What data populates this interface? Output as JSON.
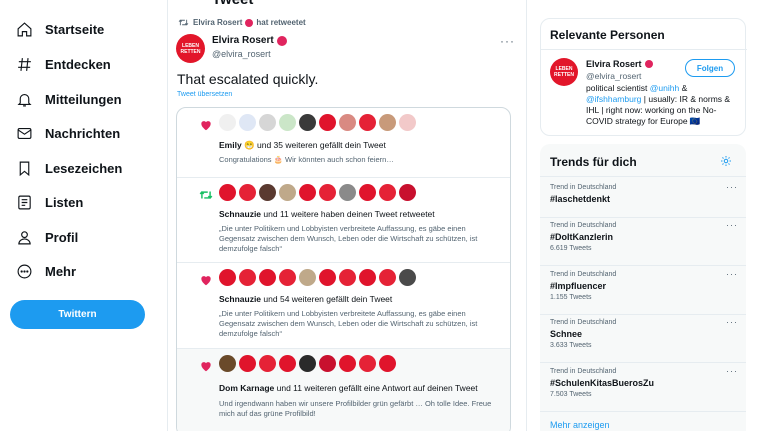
{
  "nav": {
    "items": [
      {
        "label": "Startseite",
        "icon": "home-icon"
      },
      {
        "label": "Entdecken",
        "icon": "hashtag-icon"
      },
      {
        "label": "Mitteilungen",
        "icon": "bell-icon"
      },
      {
        "label": "Nachrichten",
        "icon": "mail-icon"
      },
      {
        "label": "Lesezeichen",
        "icon": "bookmark-icon"
      },
      {
        "label": "Listen",
        "icon": "list-icon"
      },
      {
        "label": "Profil",
        "icon": "person-icon"
      },
      {
        "label": "Mehr",
        "icon": "more-circle-icon"
      }
    ],
    "tweet_button": "Twittern"
  },
  "header": {
    "title": "Tweet"
  },
  "tweet": {
    "retweet_by": "Elvira Rosert",
    "retweet_suffix": "hat retweetet",
    "author_name": "Elvira Rosert",
    "author_handle": "@elvira_rosert",
    "avatar_text": "LEBEN RETTEN",
    "text": "That escalated quickly.",
    "translate": "Tweet übersetzen"
  },
  "notifications": [
    {
      "type": "like",
      "actor": "Emily",
      "rest": "und 35 weiteren gefällt dein Tweet",
      "body": "Congratulations 🎂 Wir könnten auch schon feiern…",
      "avatars": [
        "#f0f0f0",
        "#dfe7f5",
        "#d6d6d6",
        "#cbe6c8",
        "#3a3a3a",
        "#e0142c",
        "#d98a82",
        "#e52236",
        "#c89a7a",
        "#f2c9c9"
      ]
    },
    {
      "type": "retweet",
      "actor": "Schnauzie",
      "rest": "und 11 weitere haben deinen Tweet retweetet",
      "body": "„Die unter Politikern und Lobbyisten verbreitete Auffassung, es gäbe einen Gegensatz zwischen dem Wunsch, Leben oder die Wirtschaft zu schützen, ist demzufolge falsch“",
      "avatars": [
        "#e0142c",
        "#e52236",
        "#5a3a30",
        "#bfa98a",
        "#e0142c",
        "#e52236",
        "#8a8a8a",
        "#e0142c",
        "#e52236",
        "#c8102e"
      ]
    },
    {
      "type": "like",
      "actor": "Schnauzie",
      "rest": "und 54 weiteren gefällt dein Tweet",
      "body": "„Die unter Politikern und Lobbyisten verbreitete Auffassung, es gäbe einen Gegensatz zwischen dem Wunsch, Leben oder die Wirtschaft zu schützen, ist demzufolge falsch“",
      "avatars": [
        "#e0142c",
        "#e52236",
        "#e0142c",
        "#e52236",
        "#bfa98a",
        "#e0142c",
        "#e52236",
        "#e0142c",
        "#e52236",
        "#4a4a4a"
      ]
    },
    {
      "type": "like",
      "actor": "Dom Karnage",
      "rest": "und 11 weiteren gefällt eine Antwort auf deinen Tweet",
      "body": "Und irgendwann haben wir unsere Profilbilder grün gefärbt … Oh tolle Idee. Freue mich auf das grüne Profilbild!",
      "avatars": [
        "#6a4a2a",
        "#e0142c",
        "#e52236",
        "#e0142c",
        "#2a2a2a",
        "#c8102e",
        "#e0142c",
        "#e52236",
        "#e0142c"
      ]
    }
  ],
  "relevant": {
    "title": "Relevante Personen",
    "name": "Elvira Rosert",
    "handle": "@elvira_rosert",
    "avatar_text": "LEBEN RETTEN",
    "follow": "Folgen",
    "bio_1": "political scientist",
    "bio_link1": "@unihh",
    "bio_2": "&",
    "bio_link2": "@ifshhamburg",
    "bio_3": "| usually: IR & norms & IHL | right now: working on the No-COVID strategy for Europe 🇪🇺"
  },
  "trends": {
    "title": "Trends für dich",
    "items": [
      {
        "context": "Trend in Deutschland",
        "name": "#laschetdenkt",
        "count": ""
      },
      {
        "context": "Trend in Deutschland",
        "name": "#DoItKanzlerin",
        "count": "6.619 Tweets"
      },
      {
        "context": "Trend in Deutschland",
        "name": "#Impfluencer",
        "count": "1.155 Tweets"
      },
      {
        "context": "Trend in Deutschland",
        "name": "Schnee",
        "count": "3.633 Tweets"
      },
      {
        "context": "Trend in Deutschland",
        "name": "#SchulenKitasBuerosZu",
        "count": "7.503 Tweets"
      }
    ],
    "show_more": "Mehr anzeigen"
  },
  "colors": {
    "accent": "#1d9bf0",
    "like": "#e0245e",
    "retweet": "#17bf63",
    "brand_red": "#e2162a"
  }
}
